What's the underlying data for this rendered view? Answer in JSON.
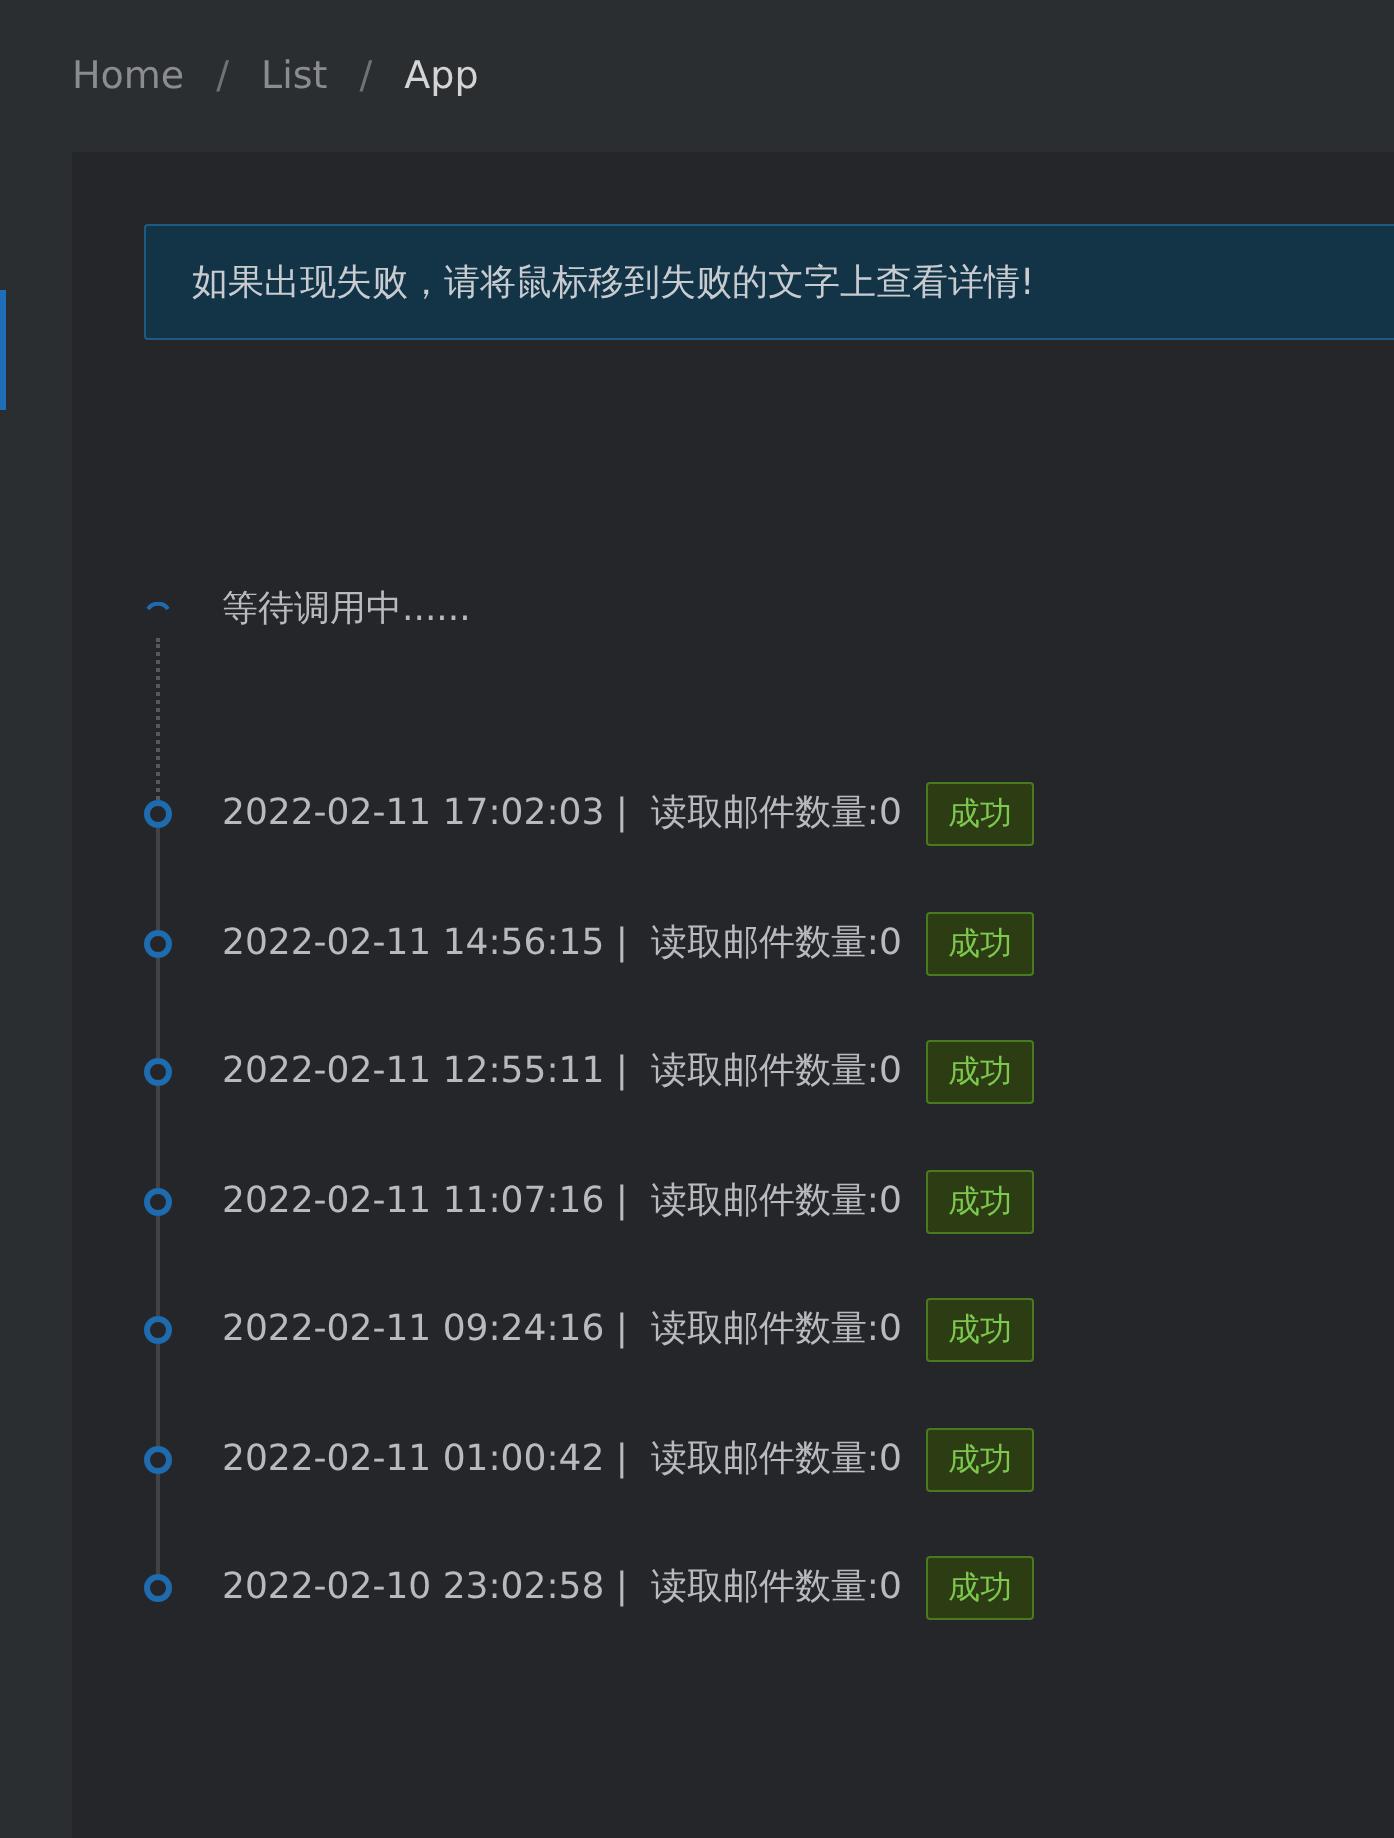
{
  "breadcrumb": [
    {
      "label": "Home",
      "current": false
    },
    {
      "label": "/",
      "kind": "separator"
    },
    {
      "label": "List",
      "current": false
    },
    {
      "label": "/",
      "kind": "separator"
    },
    {
      "label": "App",
      "current": true
    }
  ],
  "sidebar": {
    "active_indicator": true
  },
  "alert": {
    "text": "如果出现失败，请将鼠标移到失败的文字上查看详情!"
  },
  "timeline": [
    {
      "kind": "pending",
      "text": "等待调用中......"
    },
    {
      "kind": "entry",
      "text": "2022-02-11 17:02:03 |  读取邮件数量:0",
      "tag": "成功"
    },
    {
      "kind": "entry",
      "text": "2022-02-11 14:56:15 |  读取邮件数量:0",
      "tag": "成功"
    },
    {
      "kind": "entry",
      "text": "2022-02-11 12:55:11 |  读取邮件数量:0",
      "tag": "成功"
    },
    {
      "kind": "entry",
      "text": "2022-02-11 11:07:16 |  读取邮件数量:0",
      "tag": "成功"
    },
    {
      "kind": "entry",
      "text": "2022-02-11 09:24:16 |  读取邮件数量:0",
      "tag": "成功"
    },
    {
      "kind": "entry",
      "text": "2022-02-11 01:00:42 |  读取邮件数量:0",
      "tag": "成功"
    },
    {
      "kind": "entry",
      "text": "2022-02-10 23:02:58 |  读取邮件数量:0",
      "tag": "成功"
    }
  ]
}
